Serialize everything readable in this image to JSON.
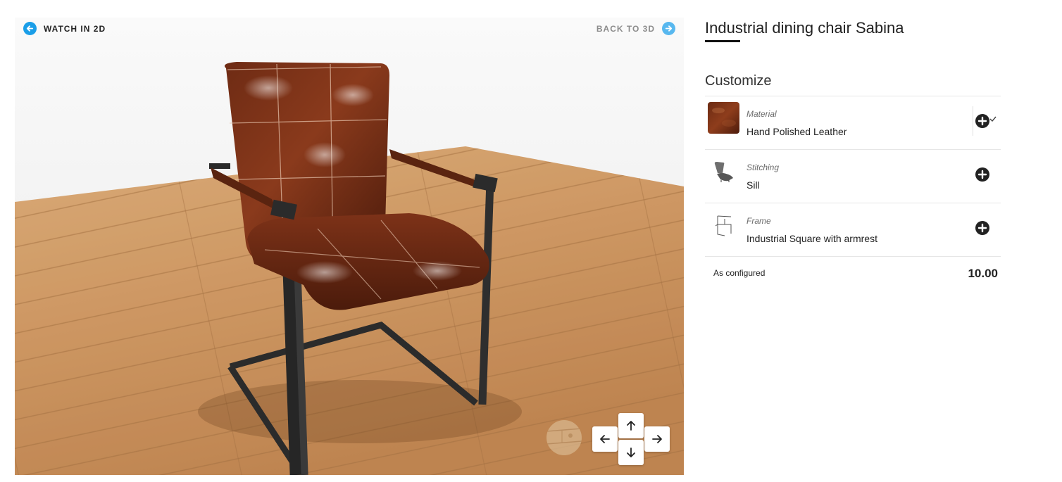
{
  "viewer": {
    "watch_2d_label": "WATCH IN 2D",
    "back_3d_label": "BACK TO 3D",
    "colors": {
      "watch_2d_icon": "#1a9ee8",
      "back_3d_icon": "#58b8ef",
      "back_3d_text": "#8c8c8c"
    },
    "controls": [
      "arrow-up-icon",
      "arrow-down-icon",
      "arrow-left-icon",
      "arrow-right-icon"
    ]
  },
  "product": {
    "title": "Industrial dining chair Sabina"
  },
  "customize": {
    "title": "Customize",
    "options": [
      {
        "label": "Material",
        "value": "Hand Polished Leather",
        "icon": "plus-circle-icon",
        "selected": true
      },
      {
        "label": "Stitching",
        "value": "Sill",
        "icon": "plus-circle-icon"
      },
      {
        "label": "Frame",
        "value": "Industrial Square with armrest",
        "icon": "plus-circle-icon"
      }
    ],
    "total_label": "As configured",
    "total_value": "10.00"
  }
}
